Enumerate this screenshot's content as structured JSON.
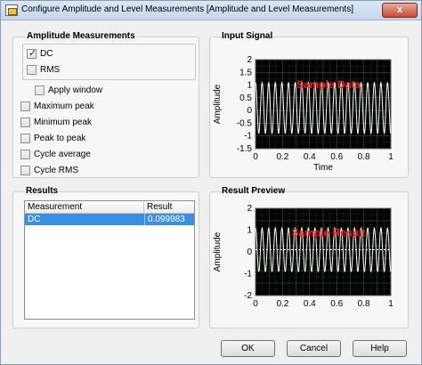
{
  "window": {
    "title": "Configure Amplitude and Level Measurements [Amplitude and Level Measurements]",
    "close_label": "x"
  },
  "amplitude_group": {
    "title": "Amplitude Measurements",
    "items": [
      {
        "label": "DC",
        "checked": true
      },
      {
        "label": "RMS",
        "checked": false
      }
    ],
    "apply_window": {
      "label": "Apply window",
      "checked": false
    },
    "more_items": [
      {
        "label": "Maximum peak",
        "checked": false
      },
      {
        "label": "Minimum peak",
        "checked": false
      },
      {
        "label": "Peak to peak",
        "checked": false
      },
      {
        "label": "Cycle average",
        "checked": false
      },
      {
        "label": "Cycle RMS",
        "checked": false
      }
    ]
  },
  "results": {
    "title": "Results",
    "columns": [
      "Measurement",
      "Result"
    ],
    "rows": [
      {
        "measurement": "DC",
        "result": "0.099983"
      }
    ]
  },
  "buttons": {
    "ok": "OK",
    "cancel": "Cancel",
    "help": "Help"
  },
  "colors": {
    "plot_bg": "#000000",
    "grid": "#2e7d2e",
    "trace": "#ffffff",
    "watermark": "#ff1a1a"
  },
  "chart_data": [
    {
      "type": "line",
      "title": "Input Signal",
      "xlabel": "Time",
      "ylabel": "Amplitude",
      "xlim": [
        0,
        1
      ],
      "ylim": [
        -1.5,
        2
      ],
      "xticks": [
        "0",
        "0.2",
        "0.4",
        "0.6",
        "0.8",
        "1"
      ],
      "yticks": [
        "2",
        "1.5",
        "1",
        "0.5",
        "0",
        "-0.5",
        "-1",
        "-1.5"
      ],
      "watermark": "Sample Data",
      "grid": true,
      "series": [
        {
          "offset": 0.1,
          "amplitude": 1.0,
          "cycles": 20.5
        }
      ]
    },
    {
      "type": "line",
      "title": "Result Preview",
      "xlabel": "",
      "ylabel": "Amplitude",
      "xlim": [
        0,
        1
      ],
      "ylim": [
        -2,
        2
      ],
      "xticks": [
        "0",
        "0.2",
        "0.4",
        "0.6",
        "0.8",
        "1"
      ],
      "yticks": [
        "2",
        "1",
        "0",
        "-1",
        "-2"
      ],
      "watermark": "Sample Result",
      "grid": true,
      "dc_line": 0.1,
      "series": [
        {
          "offset": 0.1,
          "amplitude": 1.0,
          "cycles": 20.5
        }
      ]
    }
  ]
}
